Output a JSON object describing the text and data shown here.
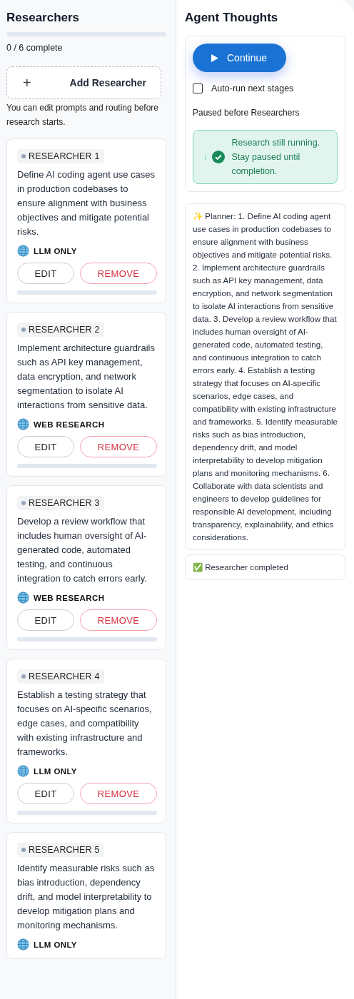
{
  "researchers_panel": {
    "title": "Researchers",
    "progress": {
      "level": 0
    },
    "progress_text": "0 / 6 complete",
    "add_button": {
      "icon": "+",
      "label": "Add Researcher"
    },
    "hint": "You can edit prompts and routing before research starts.",
    "researchers": [
      {
        "label": "RESEARCHER 1",
        "prompt": "Define AI coding agent use cases in production codebases to ensure alignment with business objectives and mitigate potential risks.",
        "mode": "LLM ONLY",
        "actions": [
          "EDIT",
          "REMOVE"
        ],
        "level": 0
      },
      {
        "label": "RESEARCHER 2",
        "prompt": "Implement architecture guardrails such as API key management, data encryption, and network segmentation to isolate AI interactions from sensitive data.",
        "mode": "WEB RESEARCH",
        "actions": [
          "EDIT",
          "REMOVE"
        ],
        "level": 0
      },
      {
        "label": "RESEARCHER 3",
        "prompt": "Develop a review workflow that includes human oversight of AI-generated code, automated testing, and continuous integration to catch errors early.",
        "mode": "WEB RESEARCH",
        "actions": [
          "EDIT",
          "REMOVE"
        ],
        "level": 0
      },
      {
        "label": "RESEARCHER 4",
        "prompt": "Establish a testing strategy that focuses on AI-specific scenarios, edge cases, and compatibility with existing infrastructure and frameworks.",
        "mode": "LLM ONLY",
        "actions": [
          "EDIT",
          "REMOVE"
        ],
        "level": 0
      },
      {
        "label": "RESEARCHER 5",
        "prompt": "Identify measurable risks such as bias introduction, dependency drift, and model interpretability to develop mitigation plans and monitoring mechanisms.",
        "mode": "LLM ONLY"
      }
    ]
  },
  "thoughts_panel": {
    "title": "Agent Thoughts",
    "continue_button": "Continue",
    "auto_run": {
      "label": "Auto-run next stages",
      "checked": false
    },
    "status": "Paused before Researchers",
    "notice": "Research still running. Stay paused until completion.",
    "messages": [
      "✨ Planner: 1. Define AI coding agent use cases in production codebases to ensure alignment with business objectives and mitigate potential risks. 2. Implement architecture guardrails such as API key management, data encryption, and network segmentation to isolate AI interactions from sensitive data. 3. Develop a review workflow that includes human oversight of AI-generated code, automated testing, and continuous integration to catch errors early. 4. Establish a testing strategy that focuses on AI-specific scenarios, edge cases, and compatibility with existing infrastructure and frameworks. 5. Identify measurable risks such as bias introduction, dependency drift, and model interpretability to develop mitigation plans and monitoring mechanisms. 6. Collaborate with data scientists and engineers to develop guidelines for responsible AI development, including transparency, explainability, and ethics considerations.",
      "✅ Researcher completed"
    ]
  }
}
